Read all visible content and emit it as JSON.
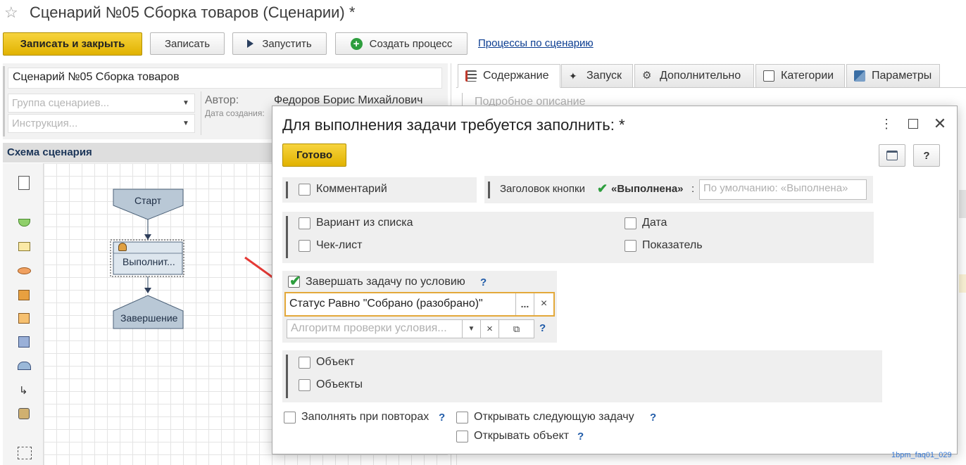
{
  "window": {
    "title": "Сценарий №05 Сборка товаров (Сценарии) *"
  },
  "toolbar": {
    "save_close": "Записать и закрыть",
    "save": "Записать",
    "run": "Запустить",
    "create_process": "Создать процесс",
    "processes_link": "Процессы по сценарию"
  },
  "form": {
    "name": "Сценарий №05 Сборка товаров",
    "group_placeholder": "Группа сценариев...",
    "instruction_placeholder": "Инструкция...",
    "author_label": "Автор:",
    "author_value": "Федоров Борис Михайлович",
    "created_label": "Дата создания:"
  },
  "schema": {
    "title": "Схема сценария",
    "nodes": {
      "start": "Старт",
      "task": "Выполнит...",
      "end": "Завершение"
    }
  },
  "tabs": [
    {
      "label": "Содержание"
    },
    {
      "label": "Запуск"
    },
    {
      "label": "Дополнительно"
    },
    {
      "label": "Категории"
    },
    {
      "label": "Параметры"
    }
  ],
  "content": {
    "description_placeholder": "Подробное описание"
  },
  "modal": {
    "title": "Для выполнения задачи требуется заполнить: *",
    "done_button": "Готово",
    "help_button": "?",
    "comment_label": "Комментарий",
    "button_caption_label": "Заголовок кнопки",
    "button_caption_bold": "«Выполнена»",
    "button_caption_colon": ":",
    "button_caption_placeholder": "По умолчанию: «Выполнена»",
    "variant_label": "Вариант из списка",
    "date_label": "Дата",
    "checklist_label": "Чек-лист",
    "indicator_label": "Показатель",
    "complete_by_condition_label": "Завершать задачу по условию",
    "condition_value": "Статус Равно \"Собрано (разобрано)\"",
    "condition_select_btn": "...",
    "condition_clear_btn": "×",
    "algorithm_placeholder": "Алгоритм проверки условия...",
    "object_label": "Объект",
    "objects_label": "Объекты",
    "fill_on_repeat_label": "Заполнять при повторах",
    "open_next_task_label": "Открывать следующую задачу",
    "open_object_label": "Открывать объект",
    "question_mark": "?"
  },
  "watermark": "1bpm_faq01_029",
  "colors": {
    "accent_yellow": "#e8c000",
    "condition_border": "#e3a83a",
    "link": "#0b3d91",
    "arrow": "#e53935"
  }
}
